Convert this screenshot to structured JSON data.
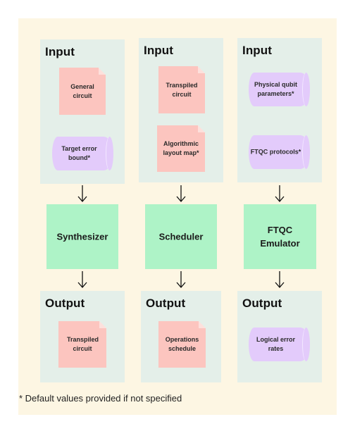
{
  "diagram": {
    "columns": [
      {
        "input": {
          "title": "Input",
          "items": [
            {
              "shape": "document",
              "label": "General circuit"
            },
            {
              "shape": "cylinder",
              "label": "Target error bound*"
            }
          ]
        },
        "process": {
          "label": "Synthesizer"
        },
        "output": {
          "title": "Output",
          "items": [
            {
              "shape": "document",
              "label": "Transpiled circuit"
            }
          ]
        }
      },
      {
        "input": {
          "title": "Input",
          "items": [
            {
              "shape": "document",
              "label": "Transpiled circuit"
            },
            {
              "shape": "document",
              "label": "Algorithmic layout map*"
            }
          ]
        },
        "process": {
          "label": "Scheduler"
        },
        "output": {
          "title": "Output",
          "items": [
            {
              "shape": "document",
              "label": "Operations schedule"
            }
          ]
        }
      },
      {
        "input": {
          "title": "Input",
          "items": [
            {
              "shape": "cylinder",
              "label": "Physical qubit parameters*"
            },
            {
              "shape": "cylinder",
              "label": "FTQC protocols*"
            }
          ]
        },
        "process": {
          "label": "FTQC Emulator"
        },
        "output": {
          "title": "Output",
          "items": [
            {
              "shape": "cylinder",
              "label": "Logical error rates"
            }
          ]
        }
      }
    ],
    "footnote": "* Default values provided if not specified",
    "colors": {
      "background": "#fdf6e3",
      "panel": "#e4efe9",
      "document": "#fcc5bf",
      "cylinder": "#e3cbfb",
      "process": "#aef3c7"
    }
  }
}
